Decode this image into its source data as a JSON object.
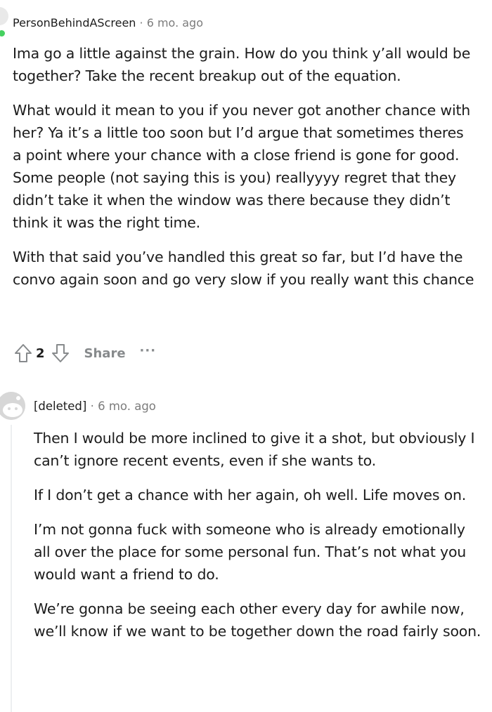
{
  "comment1": {
    "username": "PersonBehindAScreen",
    "separator": "·",
    "time": "6 mo. ago",
    "paragraphs": [
      "Ima go a little against the grain. How do you think y’all would be together? Take the recent breakup out of the equation.",
      "What would it mean to you if you never got another chance with her? Ya it’s a little too soon but I’d argue that sometimes theres a point where your chance with a close friend is gone for good. Some people (not saying this is you) reallyyyy regret that they didn’t take it when the window was there because they didn’t think it was the right time.",
      "With that said you’ve handled this great so far, but I’d have the convo again soon and go very slow if you really want this chance"
    ],
    "vote_count": "2",
    "share_label": "Share",
    "more_label": "···"
  },
  "comment2": {
    "username": "[deleted]",
    "separator": "·",
    "time": "6 mo. ago",
    "paragraphs": [
      "Then I would be more inclined to give it a shot, but obviously I can’t ignore recent events, even if she wants to.",
      "If I don’t get a chance with her again, oh well. Life moves on.",
      "I’m not gonna fuck with someone who is already emotionally all over the place for some personal fun. That’s not what you would want a friend to do.",
      "We’re gonna be seeing each other every day for awhile now, we’ll know if we want to be together down the road fairly soon."
    ]
  },
  "colors": {
    "text": "#1c1c1c",
    "meta": "#7c7c7c",
    "action": "#878a8c",
    "online": "#46d160",
    "thread_line": "#edeff1",
    "avatar_gray": "#d7d7d7"
  },
  "icons": {
    "upvote": "upvote-arrow-icon",
    "downvote": "downvote-arrow-icon",
    "avatar": "snoo-avatar-icon"
  }
}
